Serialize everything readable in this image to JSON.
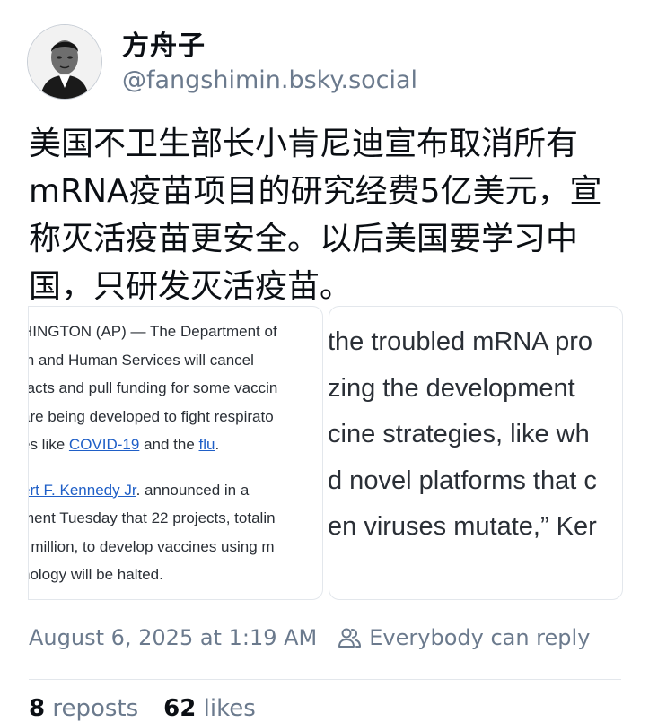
{
  "author": {
    "name": "方舟子",
    "handle": "@fangshimin.bsky.social"
  },
  "post": {
    "text": "美国不卫生部长小肯尼迪宣布取消所有mRNA疫苗项目的研究经费5亿美元，宣称灭活疫苗更安全。以后美国要学习中国，只研发灭活疫苗。"
  },
  "images": {
    "left": {
      "lines": [
        "HINGTON (AP) — The Department of",
        "th and Human Services will cancel",
        "racts and pull funding for some vaccin",
        "are being developed to fight respirato"
      ],
      "line5_prefix": "es like ",
      "link_covid": "COVID-19",
      "line5_mid": " and the ",
      "link_flu": "flu",
      "line5_suffix": ".",
      "link_rfk": "ert F. Kennedy Jr",
      "line6_suffix": ". announced in a",
      "lines2": [
        "ment Tuesday that 22 projects, totalin",
        ") million, to develop vaccines using m",
        "nology will be halted."
      ]
    },
    "right": {
      "lines": [
        "the troubled mRNA pro",
        "zing the development",
        "cine strategies, like wh",
        "d novel platforms that c",
        "en viruses mutate,” Ker"
      ]
    }
  },
  "meta": {
    "timestamp": "August 6, 2025 at 1:19 AM",
    "reply_setting": "Everybody can reply",
    "reply_icon": "people-icon"
  },
  "stats": {
    "reposts_count": "8",
    "reposts_label": "reposts",
    "likes_count": "62",
    "likes_label": "likes"
  }
}
